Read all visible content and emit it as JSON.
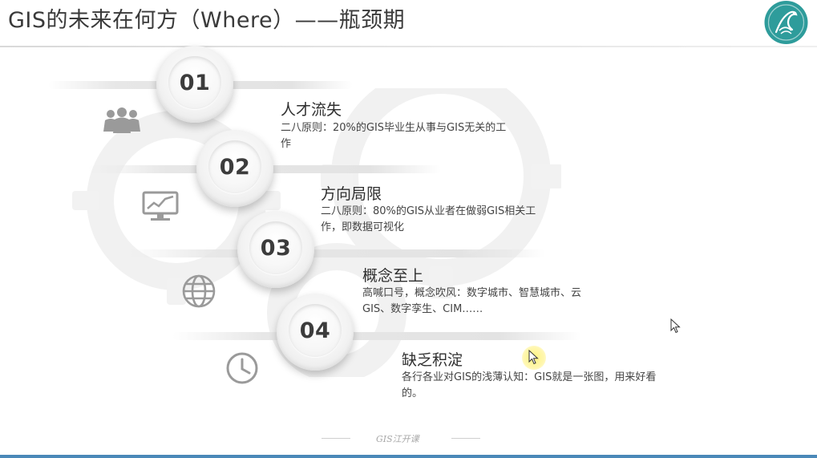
{
  "title": "GIS的未来在何方（Where）——瓶颈期",
  "items": [
    {
      "number": "01",
      "title": "人才流失",
      "desc": "二八原则：20%的GIS毕业生从事与GIS无关的工作",
      "icon": "people-group-icon"
    },
    {
      "number": "02",
      "title": "方向局限",
      "desc": "二八原则：80%的GIS从业者在做弱GIS相关工作，即数据可视化",
      "icon": "monitor-chart-icon"
    },
    {
      "number": "03",
      "title": "概念至上",
      "desc": "高喊口号，概念吹风：数字城市、智慧城市、云GIS、数字孪生、CIM……",
      "icon": "globe-icon"
    },
    {
      "number": "04",
      "title": "缺乏积淀",
      "desc": "各行各业对GIS的浅薄认知：GIS就是一张图，用来好看的。",
      "icon": "clock-icon"
    }
  ],
  "footer": {
    "text": "GIS江开课"
  },
  "colors": {
    "accent_bar": "#4a88b8",
    "logo_teal": "#2e9c9b"
  }
}
